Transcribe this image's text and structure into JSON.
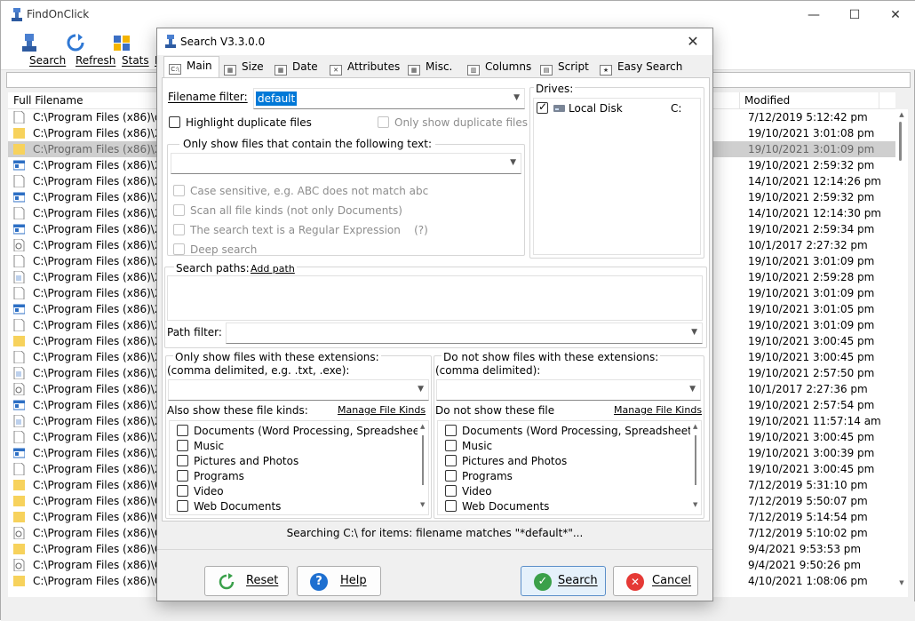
{
  "app": {
    "title": "FindOnClick"
  },
  "window_controls": {
    "minimize": "—",
    "maximize": "☐",
    "close": "✕"
  },
  "toolbar": {
    "search": "Search",
    "refresh": "Refresh",
    "stats": "Stats",
    "e": "E"
  },
  "list": {
    "header": {
      "filename": "Full Filename",
      "modified": "Modified"
    },
    "rows": [
      {
        "fn": "C:\\Program Files (x86)\\des",
        "md": "7/12/2019 5:12:42 pm",
        "icon": "file-icon"
      },
      {
        "fn": "C:\\Program Files (x86)\\2Br",
        "md": "19/10/2021 3:01:08 pm",
        "icon": "folder-icon"
      },
      {
        "fn": "C:\\Program Files (x86)\\2Br",
        "md": "19/10/2021 3:01:09 pm",
        "icon": "folder-icon"
      },
      {
        "fn": "C:\\Program Files (x86)\\2Br",
        "md": "19/10/2021 2:59:32 pm",
        "icon": "window-file-icon"
      },
      {
        "fn": "C:\\Program Files (x86)\\2Br",
        "md": "14/10/2021 12:14:26 pm",
        "icon": "file-icon"
      },
      {
        "fn": "C:\\Program Files (x86)\\2Br",
        "md": "19/10/2021 2:59:32 pm",
        "icon": "window-file-icon"
      },
      {
        "fn": "C:\\Program Files (x86)\\2Br",
        "md": "14/10/2021 12:14:30 pm",
        "icon": "file-icon"
      },
      {
        "fn": "C:\\Program Files (x86)\\2Br",
        "md": "19/10/2021 2:59:34 pm",
        "icon": "window-file-icon"
      },
      {
        "fn": "C:\\Program Files (x86)\\2Br",
        "md": "10/1/2017 2:27:32 pm",
        "icon": "gear-file-icon"
      },
      {
        "fn": "C:\\Program Files (x86)\\2Br",
        "md": "19/10/2021 3:01:09 pm",
        "icon": "file-icon"
      },
      {
        "fn": "C:\\Program Files (x86)\\2Br",
        "md": "19/10/2021 2:59:28 pm",
        "icon": "text-file-icon"
      },
      {
        "fn": "C:\\Program Files (x86)\\2Br",
        "md": "19/10/2021 3:01:09 pm",
        "icon": "file-icon"
      },
      {
        "fn": "C:\\Program Files (x86)\\2Br",
        "md": "19/10/2021 3:01:05 pm",
        "icon": "window-file-icon"
      },
      {
        "fn": "C:\\Program Files (x86)\\2Br",
        "md": "19/10/2021 3:01:09 pm",
        "icon": "file-icon"
      },
      {
        "fn": "C:\\Program Files (x86)\\2Br",
        "md": "19/10/2021 3:00:45 pm",
        "icon": "folder-icon"
      },
      {
        "fn": "C:\\Program Files (x86)\\2Br",
        "md": "19/10/2021 3:00:45 pm",
        "icon": "file-icon"
      },
      {
        "fn": "C:\\Program Files (x86)\\2Br",
        "md": "19/10/2021 2:57:50 pm",
        "icon": "text-file-icon"
      },
      {
        "fn": "C:\\Program Files (x86)\\2Br",
        "md": "10/1/2017 2:27:36 pm",
        "icon": "gear-file-icon"
      },
      {
        "fn": "C:\\Program Files (x86)\\2Br",
        "md": "19/10/2021 2:57:54 pm",
        "icon": "window-file-icon"
      },
      {
        "fn": "C:\\Program Files (x86)\\2Br",
        "md": "19/10/2021 11:57:14 am",
        "icon": "text-file-icon"
      },
      {
        "fn": "C:\\Program Files (x86)\\2Br",
        "md": "19/10/2021 3:00:45 pm",
        "icon": "file-icon"
      },
      {
        "fn": "C:\\Program Files (x86)\\2Br",
        "md": "19/10/2021 3:00:39 pm",
        "icon": "window-file-icon"
      },
      {
        "fn": "C:\\Program Files (x86)\\2Br",
        "md": "19/10/2021 3:00:45 pm",
        "icon": "file-icon"
      },
      {
        "fn": "C:\\Program Files (x86)\\Cor",
        "md": "7/12/2019 5:31:10 pm",
        "icon": "folder-icon"
      },
      {
        "fn": "C:\\Program Files (x86)\\Cor",
        "md": "7/12/2019 5:50:07 pm",
        "icon": "folder-icon"
      },
      {
        "fn": "C:\\Program Files (x86)\\Cor",
        "md": "7/12/2019 5:14:54 pm",
        "icon": "folder-icon"
      },
      {
        "fn": "C:\\Program Files (x86)\\Cor",
        "md": "7/12/2019 5:10:02 pm",
        "icon": "gear-file-icon"
      },
      {
        "fn": "C:\\Program Files (x86)\\Cor",
        "md": "9/4/2021 9:53:53 pm",
        "icon": "folder-icon"
      },
      {
        "fn": "C:\\Program Files (x86)\\Cor",
        "md": "9/4/2021 9:50:26 pm",
        "icon": "gear-file-icon"
      },
      {
        "fn": "C:\\Program Files (x86)\\Cor",
        "md": "4/10/2021 1:08:06 pm",
        "icon": "folder-icon"
      }
    ]
  },
  "dialog": {
    "title": "Search V3.3.0.0",
    "close": "✕",
    "tabs": [
      {
        "label": "Main",
        "icon": "C:\\"
      },
      {
        "label": "Size",
        "icon": "▦"
      },
      {
        "label": "Date",
        "icon": "▦"
      },
      {
        "label": "Attributes",
        "icon": "✕"
      },
      {
        "label": "Misc.",
        "icon": "▦"
      },
      {
        "label": "Columns",
        "icon": "▥"
      },
      {
        "label": "Script",
        "icon": "▤"
      },
      {
        "label": "Easy Search",
        "icon": "★"
      }
    ],
    "filename_filter_label": "Filename filter:",
    "filename_filter_value": "default",
    "highlight_duplicates": "Highlight duplicate files",
    "only_show_duplicates": "Only show duplicate files",
    "contain_text_label": "Only show files that contain the following text:",
    "case_sensitive": "Case sensitive, e.g. ABC does not match abc",
    "scan_all": "Scan all file kinds (not only Documents)",
    "regex": "The search text is a Regular Expression",
    "regex_help": "(?)",
    "deep_search": "Deep search",
    "drives_label": "Drives:",
    "drive_name": "Local Disk",
    "drive_letter": "C:",
    "search_paths_label": "Search paths:",
    "add_path": "Add path",
    "path_filter_label": "Path filter:",
    "only_ext_label1": "Only show files with these extensions:",
    "only_ext_label2": "(comma delimited, e.g. .txt, .exe):",
    "not_ext_label1": "Do not show files with these extensions:",
    "not_ext_label2": "(comma delimited):",
    "also_show_kinds": "Also show these file kinds:",
    "not_show_kind": "Do not show these file",
    "manage_kinds": "Manage File Kinds",
    "kinds": [
      "Documents (Word Processing, Spreadsheet",
      "Music",
      "Pictures and Photos",
      "Programs",
      "Video",
      "Web Documents"
    ],
    "status": "Searching C:\\ for items: filename matches \"*default*\"...",
    "btn_reset": "Reset",
    "btn_help": "Help",
    "btn_search": "Search",
    "btn_cancel": "Cancel"
  }
}
